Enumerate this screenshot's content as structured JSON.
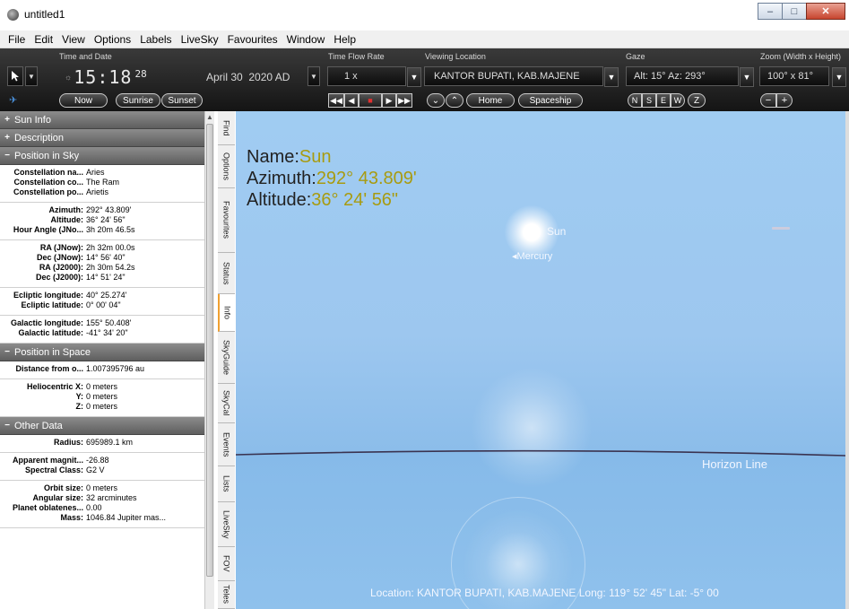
{
  "window": {
    "title": "untitled1",
    "minimize": "–",
    "maximize": "□",
    "close": "✕"
  },
  "menu": [
    "File",
    "Edit",
    "View",
    "Options",
    "Labels",
    "LiveSky",
    "Favourites",
    "Window",
    "Help"
  ],
  "toolbar": {
    "time_date_label": "Time and Date",
    "time_big": "15:18",
    "time_seconds": "28",
    "date": "April 30  2020 AD",
    "now": "Now",
    "sunrise": "Sunrise",
    "sunset": "Sunset",
    "time_flow_label": "Time Flow Rate",
    "time_flow_value": "1 x",
    "viewing_location_label": "Viewing Location",
    "viewing_location_value": "KANTOR BUPATI, KAB.MAJENE",
    "home": "Home",
    "spaceship": "Spaceship",
    "gaze_label": "Gaze",
    "gaze_value": "Alt: 15° Az: 293°",
    "gaze_n": "N",
    "gaze_s": "S",
    "gaze_e": "E",
    "gaze_w": "W",
    "gaze_z": "Z",
    "zoom_label": "Zoom (Width x Height)",
    "zoom_value": "100° x 81°",
    "zoom_out": "−",
    "zoom_in": "+"
  },
  "panel": {
    "sun_info": "Sun Info",
    "description": "Description",
    "position_in_sky": "Position in Sky",
    "position_in_space": "Position in Space",
    "other_data": "Other Data",
    "sky_groups": [
      [
        {
          "k": "Constellation na...",
          "v": "Aries"
        },
        {
          "k": "Constellation co...",
          "v": "The Ram"
        },
        {
          "k": "Constellation po...",
          "v": "Arietis"
        }
      ],
      [
        {
          "k": "Azimuth:",
          "v": "292° 43.809'"
        },
        {
          "k": "Altitude:",
          "v": "36° 24' 56\""
        },
        {
          "k": "Hour Angle (JNo...",
          "v": "3h 20m 46.5s"
        }
      ],
      [
        {
          "k": "RA (JNow):",
          "v": "2h 32m 00.0s"
        },
        {
          "k": "Dec (JNow):",
          "v": "14° 56' 40\""
        },
        {
          "k": "RA (J2000):",
          "v": "2h 30m 54.2s"
        },
        {
          "k": "Dec (J2000):",
          "v": "14° 51' 24\""
        }
      ],
      [
        {
          "k": "Ecliptic longitude:",
          "v": "40° 25.274'"
        },
        {
          "k": "Ecliptic latitude:",
          "v": "0° 00' 04\""
        }
      ],
      [
        {
          "k": "Galactic longitude:",
          "v": "155° 50.408'"
        },
        {
          "k": "Galactic latitude:",
          "v": "-41° 34' 20\""
        }
      ]
    ],
    "space_groups": [
      [
        {
          "k": "Distance from o...",
          "v": "1.007395796 au"
        }
      ],
      [
        {
          "k": "Heliocentric X:",
          "v": "0 meters"
        },
        {
          "k": "Y:",
          "v": "0 meters"
        },
        {
          "k": "Z:",
          "v": "0 meters"
        }
      ]
    ],
    "other_groups": [
      [
        {
          "k": "Radius:",
          "v": "695989.1 km"
        }
      ],
      [
        {
          "k": "Apparent magnit...",
          "v": "-26.88"
        },
        {
          "k": "Spectral Class:",
          "v": "G2 V"
        }
      ],
      [
        {
          "k": "Orbit size:",
          "v": "0 meters"
        },
        {
          "k": "Angular size:",
          "v": "32 arcminutes"
        },
        {
          "k": "Planet oblatenes...",
          "v": "0.00"
        },
        {
          "k": "Mass:",
          "v": "1046.84 Jupiter mas..."
        }
      ]
    ]
  },
  "vtabs": [
    "Find",
    "Options",
    "Favourites",
    "Status",
    "Info",
    "SkyGuide",
    "SkyCal",
    "Events",
    "Lists",
    "LiveSky",
    "FOV",
    "Teles"
  ],
  "sky": {
    "name_label": "Name:",
    "name_value": "Sun",
    "azimuth_label": "Azimuth:",
    "azimuth_value": "292° 43.809'",
    "altitude_label": "Altitude:",
    "altitude_value": "36° 24' 56\"",
    "sun_label": "Sun",
    "mercury_label": "◂Mercury",
    "horizon_label": "Horizon Line",
    "status": "Location: KANTOR BUPATI, KAB.MAJENE   Long: 119° 52' 45\" Lat: -5° 00"
  },
  "colors": {
    "accent_value": "#a89b10",
    "toolbar_bg": "#1c1c1c",
    "sky": "#9dc7ef"
  }
}
